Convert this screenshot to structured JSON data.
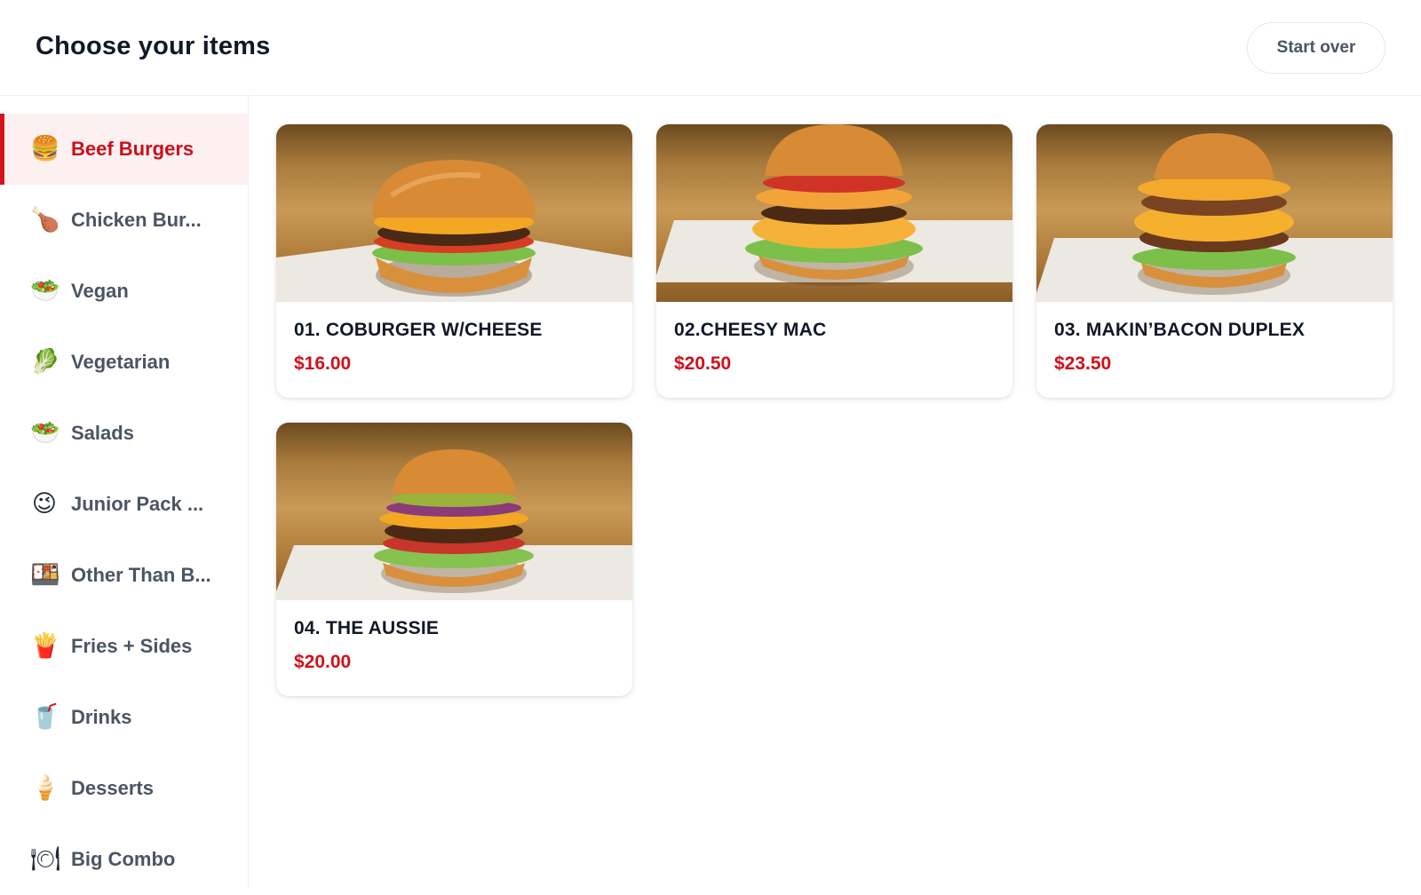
{
  "header": {
    "title": "Choose your items",
    "start_over_label": "Start over"
  },
  "sidebar": {
    "items": [
      {
        "label": "Beef Burgers",
        "icon": "🍔",
        "icon_name": "burger-icon",
        "active": true
      },
      {
        "label": "Chicken Bur...",
        "icon": "🍗",
        "icon_name": "chicken-leg-icon",
        "active": false
      },
      {
        "label": "Vegan",
        "icon": "🥗",
        "icon_name": "salad-icon",
        "active": false
      },
      {
        "label": "Vegetarian",
        "icon": "🥬",
        "icon_name": "leafy-green-icon",
        "active": false
      },
      {
        "label": "Salads",
        "icon": "🥗",
        "icon_name": "salad-icon",
        "active": false
      },
      {
        "label": "Junior Pack ...",
        "icon": "😉",
        "icon_name": "winking-face-icon",
        "active": false
      },
      {
        "label": "Other Than B...",
        "icon": "🍱",
        "icon_name": "bento-box-icon",
        "active": false
      },
      {
        "label": "Fries + Sides",
        "icon": "🍟",
        "icon_name": "fries-icon",
        "active": false
      },
      {
        "label": "Drinks",
        "icon": "🥤",
        "icon_name": "cup-with-straw-icon",
        "active": false
      },
      {
        "label": "Desserts",
        "icon": "🍦",
        "icon_name": "ice-cream-icon",
        "active": false
      },
      {
        "label": "Big Combo",
        "icon": "🍽",
        "icon_name": "plate-cutlery-icon",
        "active": false
      }
    ]
  },
  "products": [
    {
      "name": "01. COBURGER W/CHEESE",
      "price": "$16.00",
      "image": "cheeseburger-photo"
    },
    {
      "name": "02.CHEESY MAC",
      "price": "$20.50",
      "image": "cheesy-mac-burger-photo"
    },
    {
      "name": "03. MAKIN’BACON DUPLEX",
      "price": "$23.50",
      "image": "bacon-duplex-burger-photo"
    },
    {
      "name": "04. THE AUSSIE",
      "price": "$20.00",
      "image": "aussie-burger-photo"
    }
  ],
  "colors": {
    "accent": "#d0101b",
    "active_bg": "#fdf0f1",
    "text_muted": "#4b5563"
  }
}
